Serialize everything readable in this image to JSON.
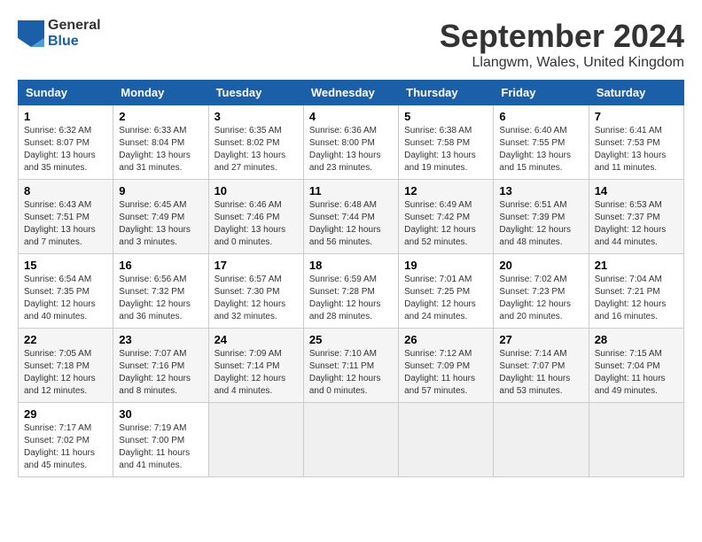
{
  "header": {
    "logo_general": "General",
    "logo_blue": "Blue",
    "title": "September 2024",
    "location": "Llangwm, Wales, United Kingdom"
  },
  "calendar": {
    "days_of_week": [
      "Sunday",
      "Monday",
      "Tuesday",
      "Wednesday",
      "Thursday",
      "Friday",
      "Saturday"
    ],
    "weeks": [
      [
        null,
        null,
        null,
        null,
        null,
        null,
        null
      ]
    ],
    "cells": [
      {
        "day": null,
        "info": null
      },
      {
        "day": null,
        "info": null
      },
      {
        "day": null,
        "info": null
      },
      {
        "day": null,
        "info": null
      },
      {
        "day": null,
        "info": null
      },
      {
        "day": null,
        "info": null
      },
      {
        "day": null,
        "info": null
      }
    ],
    "rows": [
      [
        {
          "day": "1",
          "sunrise": "Sunrise: 6:32 AM",
          "sunset": "Sunset: 8:07 PM",
          "daylight": "Daylight: 13 hours and 35 minutes."
        },
        {
          "day": "2",
          "sunrise": "Sunrise: 6:33 AM",
          "sunset": "Sunset: 8:04 PM",
          "daylight": "Daylight: 13 hours and 31 minutes."
        },
        {
          "day": "3",
          "sunrise": "Sunrise: 6:35 AM",
          "sunset": "Sunset: 8:02 PM",
          "daylight": "Daylight: 13 hours and 27 minutes."
        },
        {
          "day": "4",
          "sunrise": "Sunrise: 6:36 AM",
          "sunset": "Sunset: 8:00 PM",
          "daylight": "Daylight: 13 hours and 23 minutes."
        },
        {
          "day": "5",
          "sunrise": "Sunrise: 6:38 AM",
          "sunset": "Sunset: 7:58 PM",
          "daylight": "Daylight: 13 hours and 19 minutes."
        },
        {
          "day": "6",
          "sunrise": "Sunrise: 6:40 AM",
          "sunset": "Sunset: 7:55 PM",
          "daylight": "Daylight: 13 hours and 15 minutes."
        },
        {
          "day": "7",
          "sunrise": "Sunrise: 6:41 AM",
          "sunset": "Sunset: 7:53 PM",
          "daylight": "Daylight: 13 hours and 11 minutes."
        }
      ],
      [
        {
          "day": "8",
          "sunrise": "Sunrise: 6:43 AM",
          "sunset": "Sunset: 7:51 PM",
          "daylight": "Daylight: 13 hours and 7 minutes."
        },
        {
          "day": "9",
          "sunrise": "Sunrise: 6:45 AM",
          "sunset": "Sunset: 7:49 PM",
          "daylight": "Daylight: 13 hours and 3 minutes."
        },
        {
          "day": "10",
          "sunrise": "Sunrise: 6:46 AM",
          "sunset": "Sunset: 7:46 PM",
          "daylight": "Daylight: 13 hours and 0 minutes."
        },
        {
          "day": "11",
          "sunrise": "Sunrise: 6:48 AM",
          "sunset": "Sunset: 7:44 PM",
          "daylight": "Daylight: 12 hours and 56 minutes."
        },
        {
          "day": "12",
          "sunrise": "Sunrise: 6:49 AM",
          "sunset": "Sunset: 7:42 PM",
          "daylight": "Daylight: 12 hours and 52 minutes."
        },
        {
          "day": "13",
          "sunrise": "Sunrise: 6:51 AM",
          "sunset": "Sunset: 7:39 PM",
          "daylight": "Daylight: 12 hours and 48 minutes."
        },
        {
          "day": "14",
          "sunrise": "Sunrise: 6:53 AM",
          "sunset": "Sunset: 7:37 PM",
          "daylight": "Daylight: 12 hours and 44 minutes."
        }
      ],
      [
        {
          "day": "15",
          "sunrise": "Sunrise: 6:54 AM",
          "sunset": "Sunset: 7:35 PM",
          "daylight": "Daylight: 12 hours and 40 minutes."
        },
        {
          "day": "16",
          "sunrise": "Sunrise: 6:56 AM",
          "sunset": "Sunset: 7:32 PM",
          "daylight": "Daylight: 12 hours and 36 minutes."
        },
        {
          "day": "17",
          "sunrise": "Sunrise: 6:57 AM",
          "sunset": "Sunset: 7:30 PM",
          "daylight": "Daylight: 12 hours and 32 minutes."
        },
        {
          "day": "18",
          "sunrise": "Sunrise: 6:59 AM",
          "sunset": "Sunset: 7:28 PM",
          "daylight": "Daylight: 12 hours and 28 minutes."
        },
        {
          "day": "19",
          "sunrise": "Sunrise: 7:01 AM",
          "sunset": "Sunset: 7:25 PM",
          "daylight": "Daylight: 12 hours and 24 minutes."
        },
        {
          "day": "20",
          "sunrise": "Sunrise: 7:02 AM",
          "sunset": "Sunset: 7:23 PM",
          "daylight": "Daylight: 12 hours and 20 minutes."
        },
        {
          "day": "21",
          "sunrise": "Sunrise: 7:04 AM",
          "sunset": "Sunset: 7:21 PM",
          "daylight": "Daylight: 12 hours and 16 minutes."
        }
      ],
      [
        {
          "day": "22",
          "sunrise": "Sunrise: 7:05 AM",
          "sunset": "Sunset: 7:18 PM",
          "daylight": "Daylight: 12 hours and 12 minutes."
        },
        {
          "day": "23",
          "sunrise": "Sunrise: 7:07 AM",
          "sunset": "Sunset: 7:16 PM",
          "daylight": "Daylight: 12 hours and 8 minutes."
        },
        {
          "day": "24",
          "sunrise": "Sunrise: 7:09 AM",
          "sunset": "Sunset: 7:14 PM",
          "daylight": "Daylight: 12 hours and 4 minutes."
        },
        {
          "day": "25",
          "sunrise": "Sunrise: 7:10 AM",
          "sunset": "Sunset: 7:11 PM",
          "daylight": "Daylight: 12 hours and 0 minutes."
        },
        {
          "day": "26",
          "sunrise": "Sunrise: 7:12 AM",
          "sunset": "Sunset: 7:09 PM",
          "daylight": "Daylight: 11 hours and 57 minutes."
        },
        {
          "day": "27",
          "sunrise": "Sunrise: 7:14 AM",
          "sunset": "Sunset: 7:07 PM",
          "daylight": "Daylight: 11 hours and 53 minutes."
        },
        {
          "day": "28",
          "sunrise": "Sunrise: 7:15 AM",
          "sunset": "Sunset: 7:04 PM",
          "daylight": "Daylight: 11 hours and 49 minutes."
        }
      ],
      [
        {
          "day": "29",
          "sunrise": "Sunrise: 7:17 AM",
          "sunset": "Sunset: 7:02 PM",
          "daylight": "Daylight: 11 hours and 45 minutes."
        },
        {
          "day": "30",
          "sunrise": "Sunrise: 7:19 AM",
          "sunset": "Sunset: 7:00 PM",
          "daylight": "Daylight: 11 hours and 41 minutes."
        },
        null,
        null,
        null,
        null,
        null
      ]
    ]
  }
}
